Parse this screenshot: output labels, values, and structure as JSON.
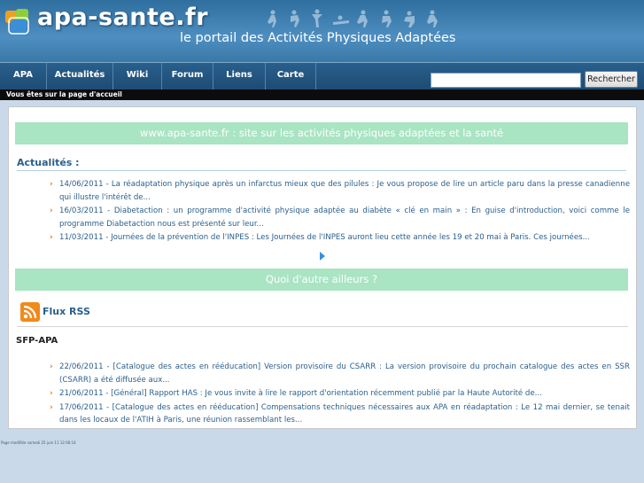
{
  "header": {
    "logo_text": "apa-sante.fr",
    "tagline": "le portail des Activités Physiques Adaptées"
  },
  "nav": {
    "items": [
      {
        "label": "APA"
      },
      {
        "label": "Actualités"
      },
      {
        "label": "Wiki"
      },
      {
        "label": "Forum"
      },
      {
        "label": "Liens"
      },
      {
        "label": "Carte"
      }
    ],
    "search_value": "",
    "search_button": "Rechercher"
  },
  "breadcrumb": "Vous êtes sur la page d'accueil",
  "main": {
    "banner": "www.apa-sante.fr : site sur les activités physiques adaptées et la santé",
    "news_title": "Actualités :",
    "news": [
      {
        "text": "14/06/2011 - La réadaptation physique après un infarctus mieux que des pilules : Je vous propose de lire un article paru dans la presse canadienne qui illustre l'intérêt de..."
      },
      {
        "text": "16/03/2011 - Diabetaction : un programme d'activité physique adaptée au diabète « clé en main » : En guise d'introduction, voici comme le programme Diabetaction nous est présenté sur leur..."
      },
      {
        "text": "11/03/2011 - Journées de la prévention de l'INPES : Les Journées de l'INPES auront lieu cette année les 19 et 20 mai à Paris. Ces journées..."
      }
    ],
    "elsewhere_banner": "Quoi d'autre ailleurs ?",
    "rss_label": "Flux RSS",
    "feed_title": "SFP-APA",
    "feed": [
      {
        "text": "22/06/2011 - [Catalogue des actes en rééducation] Version provisoire du CSARR : La version provisoire du prochain catalogue des actes en SSR (CSARR) a été diffusée aux..."
      },
      {
        "text": "21/06/2011 - [Général] Rapport HAS : Je vous invite à lire le rapport d'orientation récemment publié par la Haute Autorité de..."
      },
      {
        "text": "17/06/2011 - [Catalogue des actes en rééducation] Compensations techniques nécessaires aux APA en réadaptation : Le 12 mai dernier, se tenait dans les locaux de l'ATIH à Paris, une réunion rassemblant les..."
      }
    ]
  },
  "footer": "Page modifiée samedi 25 juin 11 12:00:14",
  "colors": {
    "header_blue": "#3a78a8",
    "nav_blue": "#1d4c75",
    "band_green": "#a9e4c3",
    "link_blue": "#2a5f8c",
    "bullet_orange": "#e07a10"
  },
  "icons": [
    "logo-icon",
    "sport-figures-icon",
    "next-arrow-icon",
    "rss-icon",
    "chevron-right-icon"
  ]
}
